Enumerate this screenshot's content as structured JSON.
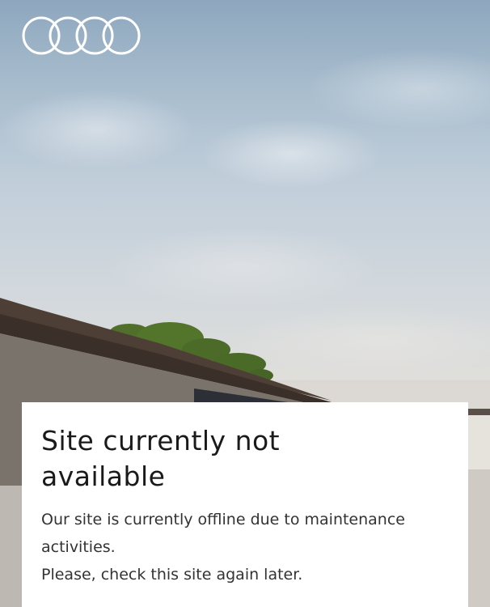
{
  "brand": {
    "logo_icon": "four-rings-logo-icon"
  },
  "message": {
    "headline": "Site currently not available",
    "line_1": "Our site is currently offline due to maintenance activities.",
    "line_2": "Please, check this site again later."
  },
  "colors": {
    "card_background": "#ffffff",
    "headline_text": "#1a1a1a",
    "body_text": "#333333",
    "logo": "#ffffff"
  }
}
